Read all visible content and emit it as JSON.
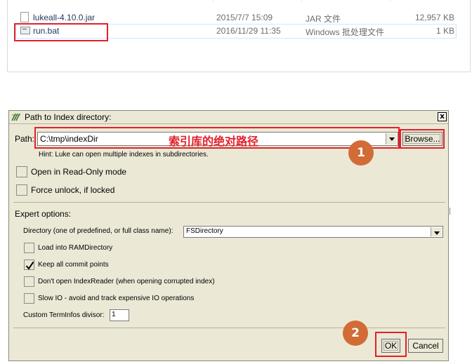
{
  "explorer": {
    "files": [
      {
        "name": "lukeall-4.10.0.jar",
        "date": "2015/7/7 15:09",
        "type": "JAR 文件",
        "size": "12,957 KB",
        "icon": "file-icon"
      },
      {
        "name": "run.bat",
        "date": "2016/11/29 11:35",
        "type": "Windows 批处理文件",
        "size": "1 KB",
        "icon": "batch-file-icon"
      }
    ]
  },
  "dialog": {
    "title": "Path to Index directory:",
    "close_label": "x",
    "path_label": "Path:",
    "path_value": "C:\\tmp\\indexDir",
    "annotation_text": "索引库的绝对路径",
    "browse_label": "Browse...",
    "hint": "Hint: Luke can open multiple indexes in subdirectories.",
    "readonly_label": "Open in Read-Only mode",
    "force_unlock_label": "Force unlock, if locked",
    "expert_title": "Expert options:",
    "directory_label": "Directory (one of predefined, or full class name):",
    "directory_value": "FSDirectory",
    "options": [
      {
        "label": "Load into RAMDirectory",
        "checked": false
      },
      {
        "label": "Keep all commit points",
        "checked": true
      },
      {
        "label": "Don't open IndexReader (when opening corrupted index)",
        "checked": false
      },
      {
        "label": "Slow IO - avoid and track expensive IO operations",
        "checked": false
      }
    ],
    "divisor_label": "Custom TermInfos divisor:",
    "divisor_value": "1",
    "ok_label": "OK",
    "cancel_label": "Cancel"
  },
  "badges": {
    "one": "1",
    "two": "2"
  },
  "colors": {
    "annotation_red": "#e3202a",
    "badge_orange": "#d36b36",
    "dialog_bg": "#ebe9d6"
  }
}
